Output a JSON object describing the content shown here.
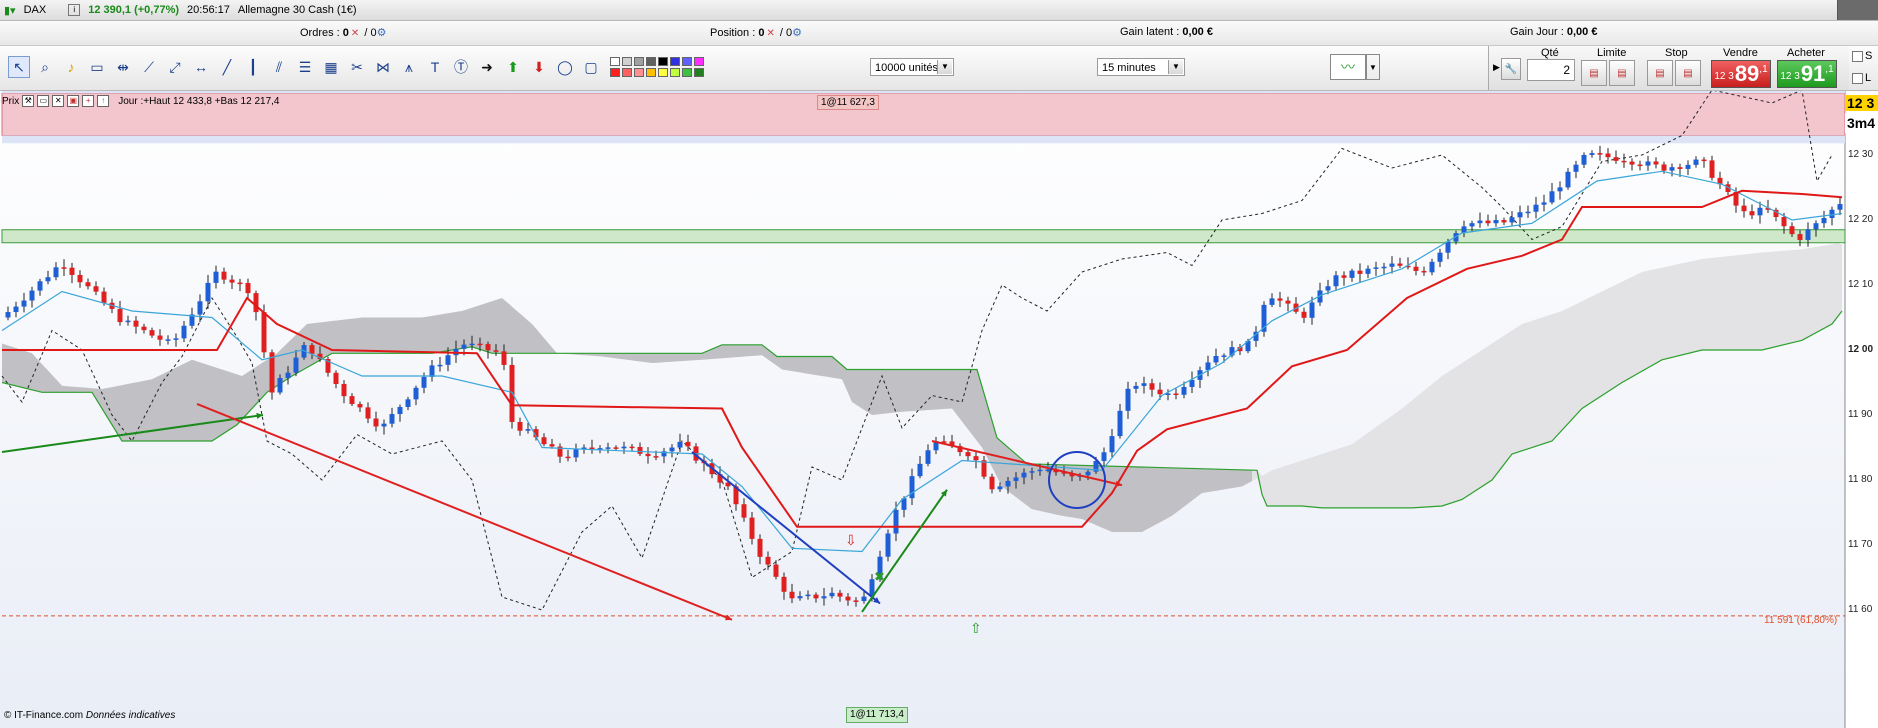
{
  "window": {
    "symbol": "DAX",
    "quote": "12 390,1 (+0,77%)",
    "time": "20:56:17",
    "instrument": "Allemagne 30 Cash (1€)"
  },
  "infobar": {
    "orders_label": "Ordres :",
    "orders_value": "0",
    "orders_sub": "/ 0",
    "position_label": "Position :",
    "position_value": "0",
    "position_sub": "/ 0",
    "gain_latent_label": "Gain latent :",
    "gain_latent_value": "0,00 €",
    "gain_jour_label": "Gain Jour :",
    "gain_jour_value": "0,00 €"
  },
  "toolbar": {
    "units_select": "10000 unités",
    "timeframe_select": "15 minutes"
  },
  "order_panel": {
    "qty_label": "Qté",
    "qty_value": "2",
    "limit_label": "Limite",
    "stop_label": "Stop",
    "sell_label": "Vendre",
    "buy_label": "Acheter",
    "sell_small": "12 3",
    "sell_big": "89",
    "sell_sup": ",1",
    "buy_small": "12 3",
    "buy_big": "91",
    "buy_sup": ",1"
  },
  "side": {
    "s_label": "S",
    "l_label": "L"
  },
  "chart_header": {
    "title": "Prix",
    "summary": "Jour :+Haut 12 433,8 +Bas 12 217,4"
  },
  "chart_labels": {
    "marker_top": "1@11 627,3",
    "marker_bottom": "1@11 713,4",
    "fibo_label": "11 591 (61,80%)",
    "price_box": "12 3",
    "time_box": "3m4",
    "copyright": "© IT-Finance.com",
    "disclaimer": "Données indicatives"
  },
  "colors": {
    "bull": "#1f5fd6",
    "bear": "#e02020",
    "kijun": "#e01818",
    "tenkan": "#3aa6d8",
    "chikou": "#222222",
    "senkou_b": "#2ca02c",
    "cloud_dark": "#bdbdc2",
    "cloud_light": "#e3e3e6",
    "resistance_zone": "#f2c6cc",
    "support_zone": "#cfe8c9"
  },
  "chart_data": {
    "type": "candlestick",
    "title": "",
    "xlabel": "",
    "ylabel": "",
    "ylim": [
      11530,
      12420
    ],
    "yticks": [
      {
        "v": 12300,
        "label": "12 30"
      },
      {
        "v": 12200,
        "label": "12 20"
      },
      {
        "v": 12100,
        "label": "12 10"
      },
      {
        "v": 12000,
        "label": "12 00"
      },
      {
        "v": 11900,
        "label": "11 90"
      },
      {
        "v": 11800,
        "label": "11 80"
      },
      {
        "v": 11700,
        "label": "11 70"
      },
      {
        "v": 11600,
        "label": "11 60"
      }
    ],
    "zones": [
      {
        "name": "resistance",
        "from": 12330,
        "to": 12395
      },
      {
        "name": "support",
        "from": 12165,
        "to": 12185
      }
    ],
    "fibo_level": 11591,
    "trendlines": [
      {
        "color": "#1a8a1a",
        "p1": [
          0,
          11843
        ],
        "p2": [
          261,
          11900
        ]
      },
      {
        "color": "#e02020",
        "p1": [
          195,
          11917
        ],
        "p2": [
          730,
          11585
        ]
      },
      {
        "color": "#1f3fc0",
        "p1": [
          690,
          11843
        ],
        "p2": [
          878,
          11610
        ]
      },
      {
        "color": "#1a8a1a",
        "p1": [
          860,
          11597
        ],
        "p2": [
          945,
          11785
        ]
      },
      {
        "color": "#e02020",
        "p1": [
          930,
          11860
        ],
        "p2": [
          1120,
          11792
        ]
      }
    ],
    "circle": {
      "x": 1075,
      "y": 11800
    },
    "anchors": [
      {
        "x": 0,
        "y": 12050
      },
      {
        "x": 60,
        "y": 12135
      },
      {
        "x": 120,
        "y": 12045
      },
      {
        "x": 170,
        "y": 12008
      },
      {
        "x": 215,
        "y": 12120
      },
      {
        "x": 250,
        "y": 12090
      },
      {
        "x": 270,
        "y": 11935
      },
      {
        "x": 305,
        "y": 12010
      },
      {
        "x": 340,
        "y": 11935
      },
      {
        "x": 380,
        "y": 11880
      },
      {
        "x": 425,
        "y": 11965
      },
      {
        "x": 460,
        "y": 12010
      },
      {
        "x": 500,
        "y": 11995
      },
      {
        "x": 510,
        "y": 11890
      },
      {
        "x": 560,
        "y": 11835
      },
      {
        "x": 600,
        "y": 11855
      },
      {
        "x": 650,
        "y": 11840
      },
      {
        "x": 680,
        "y": 11855
      },
      {
        "x": 725,
        "y": 11790
      },
      {
        "x": 760,
        "y": 11680
      },
      {
        "x": 790,
        "y": 11615
      },
      {
        "x": 830,
        "y": 11625
      },
      {
        "x": 860,
        "y": 11610
      },
      {
        "x": 890,
        "y": 11740
      },
      {
        "x": 930,
        "y": 11860
      },
      {
        "x": 970,
        "y": 11840
      },
      {
        "x": 990,
        "y": 11790
      },
      {
        "x": 1040,
        "y": 11820
      },
      {
        "x": 1075,
        "y": 11800
      },
      {
        "x": 1100,
        "y": 11835
      },
      {
        "x": 1130,
        "y": 11950
      },
      {
        "x": 1170,
        "y": 11930
      },
      {
        "x": 1210,
        "y": 11990
      },
      {
        "x": 1250,
        "y": 12010
      },
      {
        "x": 1265,
        "y": 12090
      },
      {
        "x": 1300,
        "y": 12050
      },
      {
        "x": 1330,
        "y": 12110
      },
      {
        "x": 1390,
        "y": 12130
      },
      {
        "x": 1420,
        "y": 12120
      },
      {
        "x": 1460,
        "y": 12195
      },
      {
        "x": 1500,
        "y": 12195
      },
      {
        "x": 1540,
        "y": 12225
      },
      {
        "x": 1585,
        "y": 12300
      },
      {
        "x": 1620,
        "y": 12295
      },
      {
        "x": 1660,
        "y": 12280
      },
      {
        "x": 1700,
        "y": 12290
      },
      {
        "x": 1740,
        "y": 12210
      },
      {
        "x": 1765,
        "y": 12215
      },
      {
        "x": 1795,
        "y": 12170
      },
      {
        "x": 1820,
        "y": 12200
      },
      {
        "x": 1840,
        "y": 12230
      }
    ],
    "kijun": [
      {
        "x": 0,
        "y": 12000
      },
      {
        "x": 215,
        "y": 12000
      },
      {
        "x": 245,
        "y": 12080
      },
      {
        "x": 275,
        "y": 12040
      },
      {
        "x": 330,
        "y": 12000
      },
      {
        "x": 475,
        "y": 11995
      },
      {
        "x": 510,
        "y": 11915
      },
      {
        "x": 720,
        "y": 11910
      },
      {
        "x": 740,
        "y": 11850
      },
      {
        "x": 795,
        "y": 11728
      },
      {
        "x": 1080,
        "y": 11728
      },
      {
        "x": 1110,
        "y": 11780
      },
      {
        "x": 1135,
        "y": 11845
      },
      {
        "x": 1165,
        "y": 11878
      },
      {
        "x": 1245,
        "y": 11910
      },
      {
        "x": 1290,
        "y": 11975
      },
      {
        "x": 1345,
        "y": 12000
      },
      {
        "x": 1405,
        "y": 12080
      },
      {
        "x": 1465,
        "y": 12125
      },
      {
        "x": 1520,
        "y": 12145
      },
      {
        "x": 1560,
        "y": 12170
      },
      {
        "x": 1580,
        "y": 12220
      },
      {
        "x": 1700,
        "y": 12220
      },
      {
        "x": 1740,
        "y": 12245
      },
      {
        "x": 1800,
        "y": 12240
      },
      {
        "x": 1840,
        "y": 12235
      }
    ],
    "tenkan": [
      {
        "x": 0,
        "y": 12030
      },
      {
        "x": 60,
        "y": 12090
      },
      {
        "x": 130,
        "y": 12060
      },
      {
        "x": 210,
        "y": 12050
      },
      {
        "x": 260,
        "y": 11985
      },
      {
        "x": 300,
        "y": 12000
      },
      {
        "x": 360,
        "y": 11960
      },
      {
        "x": 440,
        "y": 11960
      },
      {
        "x": 510,
        "y": 11935
      },
      {
        "x": 540,
        "y": 11850
      },
      {
        "x": 620,
        "y": 11845
      },
      {
        "x": 700,
        "y": 11840
      },
      {
        "x": 740,
        "y": 11790
      },
      {
        "x": 790,
        "y": 11695
      },
      {
        "x": 860,
        "y": 11690
      },
      {
        "x": 900,
        "y": 11770
      },
      {
        "x": 960,
        "y": 11830
      },
      {
        "x": 1100,
        "y": 11815
      },
      {
        "x": 1160,
        "y": 11930
      },
      {
        "x": 1220,
        "y": 11980
      },
      {
        "x": 1270,
        "y": 12045
      },
      {
        "x": 1320,
        "y": 12085
      },
      {
        "x": 1400,
        "y": 12125
      },
      {
        "x": 1460,
        "y": 12180
      },
      {
        "x": 1530,
        "y": 12195
      },
      {
        "x": 1595,
        "y": 12260
      },
      {
        "x": 1660,
        "y": 12275
      },
      {
        "x": 1720,
        "y": 12255
      },
      {
        "x": 1790,
        "y": 12200
      },
      {
        "x": 1840,
        "y": 12210
      }
    ],
    "chikou": [
      {
        "x": 0,
        "y": 11960
      },
      {
        "x": 20,
        "y": 11920
      },
      {
        "x": 50,
        "y": 12030
      },
      {
        "x": 80,
        "y": 12000
      },
      {
        "x": 110,
        "y": 11900
      },
      {
        "x": 130,
        "y": 11860
      },
      {
        "x": 160,
        "y": 11950
      },
      {
        "x": 180,
        "y": 11990
      },
      {
        "x": 210,
        "y": 12080
      },
      {
        "x": 235,
        "y": 12020
      },
      {
        "x": 250,
        "y": 11980
      },
      {
        "x": 265,
        "y": 11860
      },
      {
        "x": 290,
        "y": 11840
      },
      {
        "x": 320,
        "y": 11800
      },
      {
        "x": 355,
        "y": 11870
      },
      {
        "x": 390,
        "y": 11840
      },
      {
        "x": 440,
        "y": 11860
      },
      {
        "x": 470,
        "y": 11800
      },
      {
        "x": 500,
        "y": 11620
      },
      {
        "x": 540,
        "y": 11600
      },
      {
        "x": 580,
        "y": 11720
      },
      {
        "x": 610,
        "y": 11760
      },
      {
        "x": 640,
        "y": 11680
      },
      {
        "x": 680,
        "y": 11860
      },
      {
        "x": 720,
        "y": 11800
      },
      {
        "x": 750,
        "y": 11650
      },
      {
        "x": 790,
        "y": 11690
      },
      {
        "x": 810,
        "y": 11820
      },
      {
        "x": 840,
        "y": 11800
      },
      {
        "x": 880,
        "y": 11960
      },
      {
        "x": 900,
        "y": 11880
      },
      {
        "x": 930,
        "y": 11930
      },
      {
        "x": 960,
        "y": 11920
      },
      {
        "x": 980,
        "y": 12030
      },
      {
        "x": 1000,
        "y": 12100
      },
      {
        "x": 1020,
        "y": 12080
      },
      {
        "x": 1045,
        "y": 12060
      },
      {
        "x": 1080,
        "y": 12120
      },
      {
        "x": 1120,
        "y": 12140
      },
      {
        "x": 1165,
        "y": 12150
      },
      {
        "x": 1190,
        "y": 12130
      },
      {
        "x": 1220,
        "y": 12200
      },
      {
        "x": 1260,
        "y": 12210
      },
      {
        "x": 1300,
        "y": 12230
      },
      {
        "x": 1340,
        "y": 12310
      },
      {
        "x": 1390,
        "y": 12280
      },
      {
        "x": 1440,
        "y": 12300
      },
      {
        "x": 1480,
        "y": 12250
      },
      {
        "x": 1500,
        "y": 12220
      },
      {
        "x": 1530,
        "y": 12170
      },
      {
        "x": 1560,
        "y": 12190
      },
      {
        "x": 1600,
        "y": 12290
      },
      {
        "x": 1640,
        "y": 12300
      },
      {
        "x": 1680,
        "y": 12330
      },
      {
        "x": 1710,
        "y": 12400
      },
      {
        "x": 1740,
        "y": 12390
      },
      {
        "x": 1770,
        "y": 12380
      },
      {
        "x": 1800,
        "y": 12400
      },
      {
        "x": 1815,
        "y": 12260
      },
      {
        "x": 1830,
        "y": 12300
      }
    ],
    "senkou_b": [
      {
        "x": 0,
        "y": 11950
      },
      {
        "x": 40,
        "y": 11935
      },
      {
        "x": 90,
        "y": 11935
      },
      {
        "x": 120,
        "y": 11860
      },
      {
        "x": 210,
        "y": 11860
      },
      {
        "x": 235,
        "y": 11885
      },
      {
        "x": 265,
        "y": 11935
      },
      {
        "x": 290,
        "y": 11960
      },
      {
        "x": 330,
        "y": 11995
      },
      {
        "x": 430,
        "y": 11995
      },
      {
        "x": 470,
        "y": 12005
      },
      {
        "x": 490,
        "y": 11995
      },
      {
        "x": 700,
        "y": 11995
      },
      {
        "x": 720,
        "y": 12008
      },
      {
        "x": 760,
        "y": 12008
      },
      {
        "x": 775,
        "y": 11990
      },
      {
        "x": 830,
        "y": 11990
      },
      {
        "x": 845,
        "y": 11970
      },
      {
        "x": 975,
        "y": 11970
      },
      {
        "x": 995,
        "y": 11865
      },
      {
        "x": 1025,
        "y": 11825
      },
      {
        "x": 1255,
        "y": 11815
      },
      {
        "x": 1260,
        "y": 11778
      },
      {
        "x": 1265,
        "y": 11760
      },
      {
        "x": 1300,
        "y": 11760
      },
      {
        "x": 1320,
        "y": 11757
      },
      {
        "x": 1410,
        "y": 11757
      },
      {
        "x": 1440,
        "y": 11760
      },
      {
        "x": 1460,
        "y": 11770
      },
      {
        "x": 1490,
        "y": 11800
      },
      {
        "x": 1510,
        "y": 11840
      },
      {
        "x": 1550,
        "y": 11860
      },
      {
        "x": 1580,
        "y": 11910
      },
      {
        "x": 1620,
        "y": 11950
      },
      {
        "x": 1660,
        "y": 11985
      },
      {
        "x": 1700,
        "y": 12000
      },
      {
        "x": 1760,
        "y": 12000
      },
      {
        "x": 1800,
        "y": 12015
      },
      {
        "x": 1830,
        "y": 12040
      },
      {
        "x": 1840,
        "y": 12060
      }
    ],
    "senkou_a": [
      {
        "x": 0,
        "y": 12010
      },
      {
        "x": 30,
        "y": 11995
      },
      {
        "x": 60,
        "y": 11945
      },
      {
        "x": 100,
        "y": 11940
      },
      {
        "x": 150,
        "y": 11955
      },
      {
        "x": 190,
        "y": 11985
      },
      {
        "x": 240,
        "y": 11960
      },
      {
        "x": 275,
        "y": 11995
      },
      {
        "x": 305,
        "y": 12040
      },
      {
        "x": 360,
        "y": 12050
      },
      {
        "x": 420,
        "y": 12050
      },
      {
        "x": 460,
        "y": 12060
      },
      {
        "x": 500,
        "y": 12080
      },
      {
        "x": 530,
        "y": 12040
      },
      {
        "x": 555,
        "y": 11995
      },
      {
        "x": 600,
        "y": 11990
      },
      {
        "x": 650,
        "y": 11980
      },
      {
        "x": 700,
        "y": 11985
      },
      {
        "x": 760,
        "y": 11992
      },
      {
        "x": 780,
        "y": 11970
      },
      {
        "x": 840,
        "y": 11955
      },
      {
        "x": 850,
        "y": 11920
      },
      {
        "x": 870,
        "y": 11900
      },
      {
        "x": 900,
        "y": 11905
      },
      {
        "x": 950,
        "y": 11910
      },
      {
        "x": 980,
        "y": 11850
      },
      {
        "x": 1000,
        "y": 11790
      },
      {
        "x": 1030,
        "y": 11755
      },
      {
        "x": 1060,
        "y": 11745
      },
      {
        "x": 1080,
        "y": 11740
      },
      {
        "x": 1110,
        "y": 11720
      },
      {
        "x": 1140,
        "y": 11720
      },
      {
        "x": 1170,
        "y": 11745
      },
      {
        "x": 1200,
        "y": 11780
      },
      {
        "x": 1240,
        "y": 11790
      },
      {
        "x": 1270,
        "y": 11815
      },
      {
        "x": 1350,
        "y": 11855
      },
      {
        "x": 1400,
        "y": 11910
      },
      {
        "x": 1440,
        "y": 11960
      },
      {
        "x": 1480,
        "y": 12000
      },
      {
        "x": 1520,
        "y": 12040
      },
      {
        "x": 1560,
        "y": 12060
      },
      {
        "x": 1600,
        "y": 12090
      },
      {
        "x": 1640,
        "y": 12120
      },
      {
        "x": 1700,
        "y": 12140
      },
      {
        "x": 1760,
        "y": 12150
      },
      {
        "x": 1800,
        "y": 12155
      },
      {
        "x": 1840,
        "y": 12165
      }
    ]
  }
}
